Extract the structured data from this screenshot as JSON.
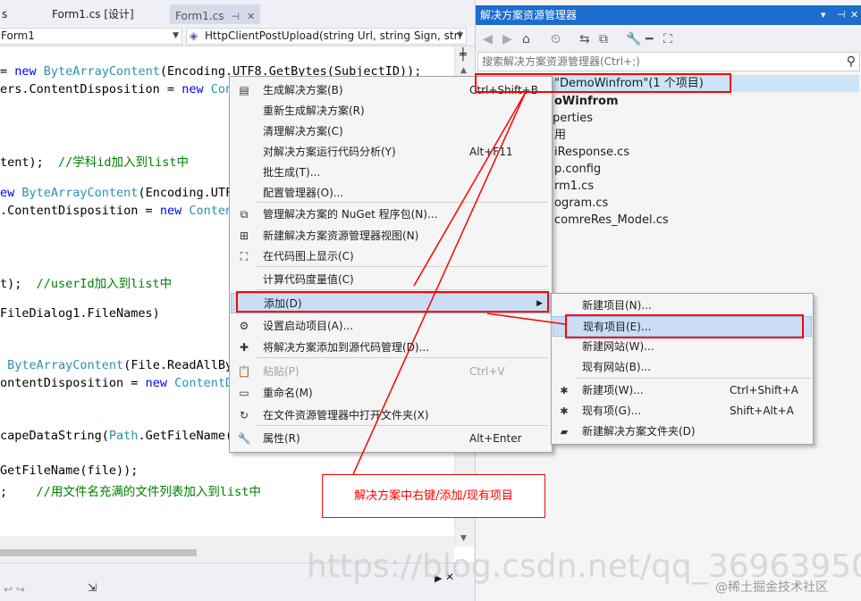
{
  "editor": {
    "tabs": [
      {
        "label": "s"
      },
      {
        "label": "Form1.cs [设计]"
      },
      {
        "label": "Form1.cs",
        "pin": "⊣",
        "close": "✕"
      }
    ],
    "nav": {
      "class_combo": "Form1",
      "method_combo": "HttpClientPostUpload(string Url, string Sign, stri"
    }
  },
  "code_lines": [
    {
      "parts": [
        [
          "",
          "= "
        ],
        [
          "kw",
          "new "
        ],
        [
          "ty",
          "ByteArrayContent"
        ],
        [
          "",
          "(Encoding.UTF8.GetBytes(SubjectID));"
        ]
      ]
    },
    {
      "parts": [
        [
          "",
          "ers.ContentDisposition = "
        ],
        [
          "kw",
          "new "
        ],
        [
          "ty",
          "Cont"
        ]
      ]
    },
    {
      "parts": [
        [
          "",
          "tent);  "
        ],
        [
          "cm",
          "//学科id加入到list中"
        ]
      ]
    },
    {
      "parts": [
        [
          "kw",
          "ew "
        ],
        [
          "ty",
          "ByteArrayContent"
        ],
        [
          "",
          "(Encoding.UTF8"
        ]
      ]
    },
    {
      "parts": [
        [
          "",
          ".ContentDisposition = "
        ],
        [
          "kw",
          "new "
        ],
        [
          "ty",
          "Content"
        ]
      ]
    },
    {
      "parts": [
        [
          "",
          "t);  "
        ],
        [
          "cm",
          "//userId加入到list中"
        ]
      ]
    },
    {
      "parts": [
        [
          "",
          "FileDialog1.FileNames)"
        ]
      ]
    },
    {
      "parts": [
        [
          "",
          " "
        ],
        [
          "ty",
          "ByteArrayContent"
        ],
        [
          "",
          "(File.ReadAllByt"
        ]
      ]
    },
    {
      "parts": [
        [
          "",
          "ontentDisposition = "
        ],
        [
          "kw",
          "new "
        ],
        [
          "ty",
          "ContentDi"
        ]
      ]
    },
    {
      "parts": [
        [
          "",
          "capeDataString("
        ],
        [
          "ty",
          "Path"
        ],
        [
          "",
          ".GetFileName(f"
        ]
      ]
    },
    {
      "parts": [
        [
          "",
          "GetFileName(file));"
        ]
      ]
    },
    {
      "parts": [
        [
          "",
          ";    "
        ],
        [
          "cm",
          "//用文件名充满的文件列表加入到list中"
        ]
      ]
    }
  ],
  "solution_explorer": {
    "title": "解决方案资源管理器",
    "title_buttons": {
      "dropdown": "▾",
      "pin": "⊣",
      "close": "✕"
    },
    "search_placeholder": "搜索解决方案资源管理器(Ctrl+;)",
    "tree": [
      {
        "label": "\"DemoWinfrom\"(1 个项目)"
      },
      {
        "label": "oWinfrom",
        "bold": true
      },
      {
        "label": "operties"
      },
      {
        "label": "用"
      },
      {
        "label": "iResponse.cs"
      },
      {
        "label": "p.config"
      },
      {
        "label": "rm1.cs"
      },
      {
        "label": "ogram.cs"
      },
      {
        "label": "comreRes_Model.cs"
      }
    ]
  },
  "context_menu": {
    "items": [
      {
        "icon": "build-icon",
        "glyph": "▤",
        "label": "生成解决方案(B)",
        "shortcut": "Ctrl+Shift+B"
      },
      {
        "icon": "",
        "glyph": "",
        "label": "重新生成解决方案(R)",
        "shortcut": ""
      },
      {
        "icon": "",
        "glyph": "",
        "label": "清理解决方案(C)",
        "shortcut": ""
      },
      {
        "icon": "",
        "glyph": "",
        "label": "对解决方案运行代码分析(Y)",
        "shortcut": "Alt+F11"
      },
      {
        "icon": "",
        "glyph": "",
        "label": "批生成(T)...",
        "shortcut": ""
      },
      {
        "icon": "",
        "glyph": "",
        "label": "配置管理器(O)...",
        "shortcut": ""
      },
      {
        "icon": "nuget-icon",
        "glyph": "⧉",
        "label": "管理解决方案的 NuGet 程序包(N)...",
        "shortcut": ""
      },
      {
        "icon": "new-view-icon",
        "glyph": "⊞",
        "label": "新建解决方案资源管理器视图(N)",
        "shortcut": ""
      },
      {
        "icon": "code-map-icon",
        "glyph": "⛶",
        "label": "在代码图上显示(C)",
        "shortcut": ""
      },
      {
        "icon": "",
        "glyph": "",
        "label": "计算代码度量值(C)",
        "shortcut": ""
      },
      {
        "icon": "",
        "glyph": "",
        "label": "添加(D)",
        "shortcut": "",
        "submenu": true,
        "highlighted": true
      },
      {
        "icon": "gear-icon",
        "glyph": "⚙",
        "label": "设置启动项目(A)...",
        "shortcut": ""
      },
      {
        "icon": "source-control-icon",
        "glyph": "✚",
        "label": "将解决方案添加到源代码管理(D)...",
        "shortcut": ""
      },
      {
        "icon": "paste-icon",
        "glyph": "📋",
        "label": "粘贴(P)",
        "shortcut": "Ctrl+V",
        "disabled": true
      },
      {
        "icon": "rename-icon",
        "glyph": "▭",
        "label": "重命名(M)",
        "shortcut": ""
      },
      {
        "icon": "open-folder-icon",
        "glyph": "↻",
        "label": "在文件资源管理器中打开文件夹(X)",
        "shortcut": ""
      },
      {
        "icon": "wrench-icon",
        "glyph": "🔧",
        "label": "属性(R)",
        "shortcut": "Alt+Enter"
      }
    ]
  },
  "submenu": {
    "items": [
      {
        "icon": "",
        "glyph": "",
        "label": "新建项目(N)...",
        "shortcut": ""
      },
      {
        "icon": "",
        "glyph": "",
        "label": "现有项目(E)...",
        "shortcut": "",
        "highlighted": true
      },
      {
        "icon": "",
        "glyph": "",
        "label": "新建网站(W)...",
        "shortcut": ""
      },
      {
        "icon": "",
        "glyph": "",
        "label": "现有网站(B)...",
        "shortcut": ""
      },
      {
        "icon": "new-item-icon",
        "glyph": "✱",
        "label": "新建项(W)...",
        "shortcut": "Ctrl+Shift+A"
      },
      {
        "icon": "existing-item-icon",
        "glyph": "✱",
        "label": "现有项(G)...",
        "shortcut": "Shift+Alt+A"
      },
      {
        "icon": "solution-folder-icon",
        "glyph": "▰",
        "label": "新建解决方案文件夹(D)",
        "shortcut": ""
      }
    ]
  },
  "annotation": {
    "text": "解决方案中右键/添加/现有项目",
    "color": "#ff0000"
  },
  "watermark": {
    "url": "https://blog.csdn.net/qq_36963950",
    "brand": "@稀土掘金技术社区"
  },
  "colors": {
    "accent": "#1c6dcc",
    "highlight": "#c9def5",
    "annotation": "#ff0000"
  }
}
